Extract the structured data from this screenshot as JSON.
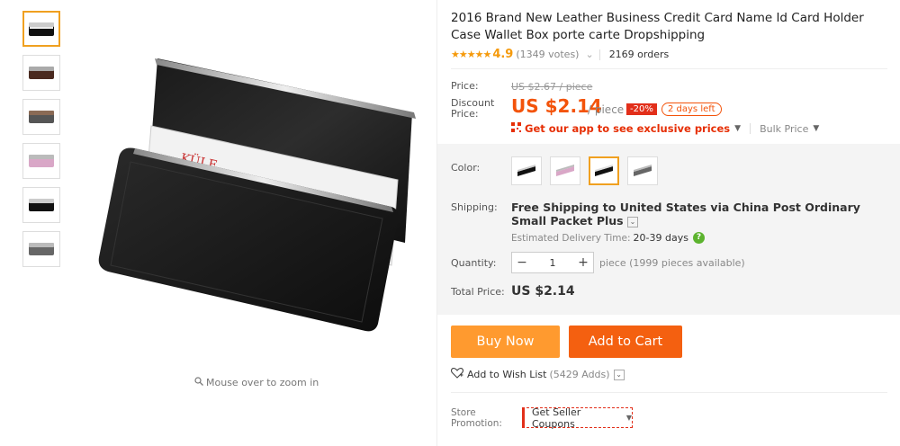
{
  "product": {
    "title": "2016 Brand New Leather Business Credit Card Name Id Card Holder Case Wallet Box porte carte Dropshipping",
    "rating": {
      "stars": "★★★★★",
      "score": "4.9",
      "votes": "(1349 votes)",
      "orders": "2169 orders"
    },
    "price": {
      "label": "Price:",
      "original": "US $2.67 / piece",
      "discount_label_1": "Discount",
      "discount_label_2": "Price:",
      "discounted": "US $2.14",
      "per_piece": "/ piece",
      "discount_pct": "-20%",
      "days_left": "2 days left"
    },
    "app_promo": {
      "text": "Get our app to see exclusive prices",
      "bulk": "Bulk Price"
    },
    "color": {
      "label": "Color:",
      "selected_index": 2,
      "options": [
        "black-silver",
        "pink",
        "black",
        "grey"
      ]
    },
    "shipping": {
      "label": "Shipping:",
      "method": "Free Shipping to United States via China Post Ordinary Small Packet Plus",
      "eta_label": "Estimated Delivery Time:",
      "eta_days": "20-39 days"
    },
    "quantity": {
      "label": "Quantity:",
      "value": "1",
      "available": "piece (1999 pieces available)"
    },
    "total": {
      "label": "Total Price:",
      "value": "US $2.14"
    },
    "buttons": {
      "buy_now": "Buy Now",
      "add_to_cart": "Add to Cart"
    },
    "wishlist": {
      "label": "Add to Wish List",
      "adds": "(5429 Adds)"
    },
    "store": {
      "label_1": "Store",
      "label_2": "Promotion:",
      "coupon": "Get Seller Coupons"
    }
  },
  "gallery": {
    "zoom_hint": "Mouse over to zoom in",
    "thumb_count": 6,
    "active_thumb": 0
  },
  "colors": {
    "accent": "#f3530a",
    "buy": "#ff9a2f",
    "cart": "#f46010",
    "star": "#f59a0c",
    "selected_border": "#f0a020"
  }
}
